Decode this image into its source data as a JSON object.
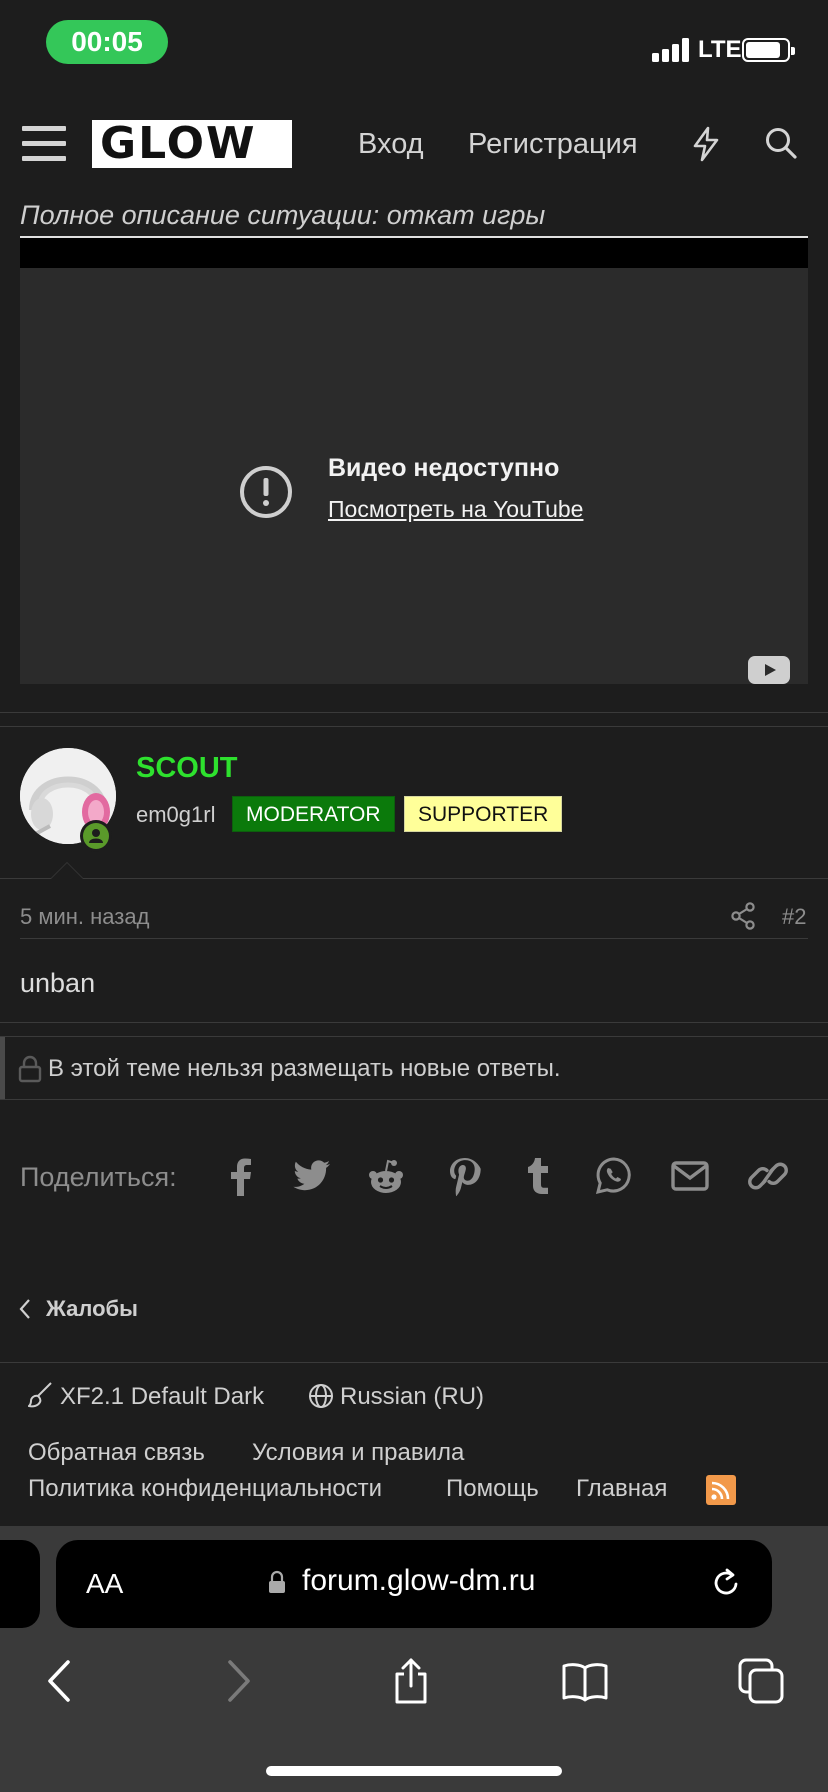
{
  "status_bar": {
    "time": "00:05",
    "network": "LTE"
  },
  "header": {
    "logo_text": "GLOW",
    "login_label": "Вход",
    "register_label": "Регистрация"
  },
  "first_post": {
    "description": "Полное описание ситуации: откат игры",
    "video_message": "Видео недоступно",
    "video_link": "Посмотреть на YouTube"
  },
  "second_post": {
    "username": "SCOUT",
    "user_title": "em0g1rl",
    "badge_moderator": "MODERATOR",
    "badge_supporter": "SUPPORTER",
    "time": "5 мин. назад",
    "number": "#2",
    "body": "unban"
  },
  "locked_notice": "В этой теме нельзя размещать новые ответы.",
  "share": {
    "label": "Поделиться:",
    "icons": [
      "facebook-icon",
      "twitter-icon",
      "reddit-icon",
      "pinterest-icon",
      "tumblr-icon",
      "whatsapp-icon",
      "email-icon",
      "link-icon"
    ]
  },
  "breadcrumb": {
    "label": "Жалобы"
  },
  "footer": {
    "style": "XF2.1 Default Dark",
    "language": "Russian (RU)",
    "links": [
      "Обратная связь",
      "Условия и правила",
      "Политика конфиденциальности",
      "Помощь",
      "Главная"
    ]
  },
  "browser": {
    "aa": "AA",
    "url": "forum.glow-dm.ru"
  },
  "colors": {
    "background": "#1d1d1d",
    "username": "#2ee12e",
    "moderator_badge": "#0b7a0b",
    "supporter_badge": "#ffff99",
    "status_pill": "#34c759",
    "rss": "#f2994a"
  }
}
